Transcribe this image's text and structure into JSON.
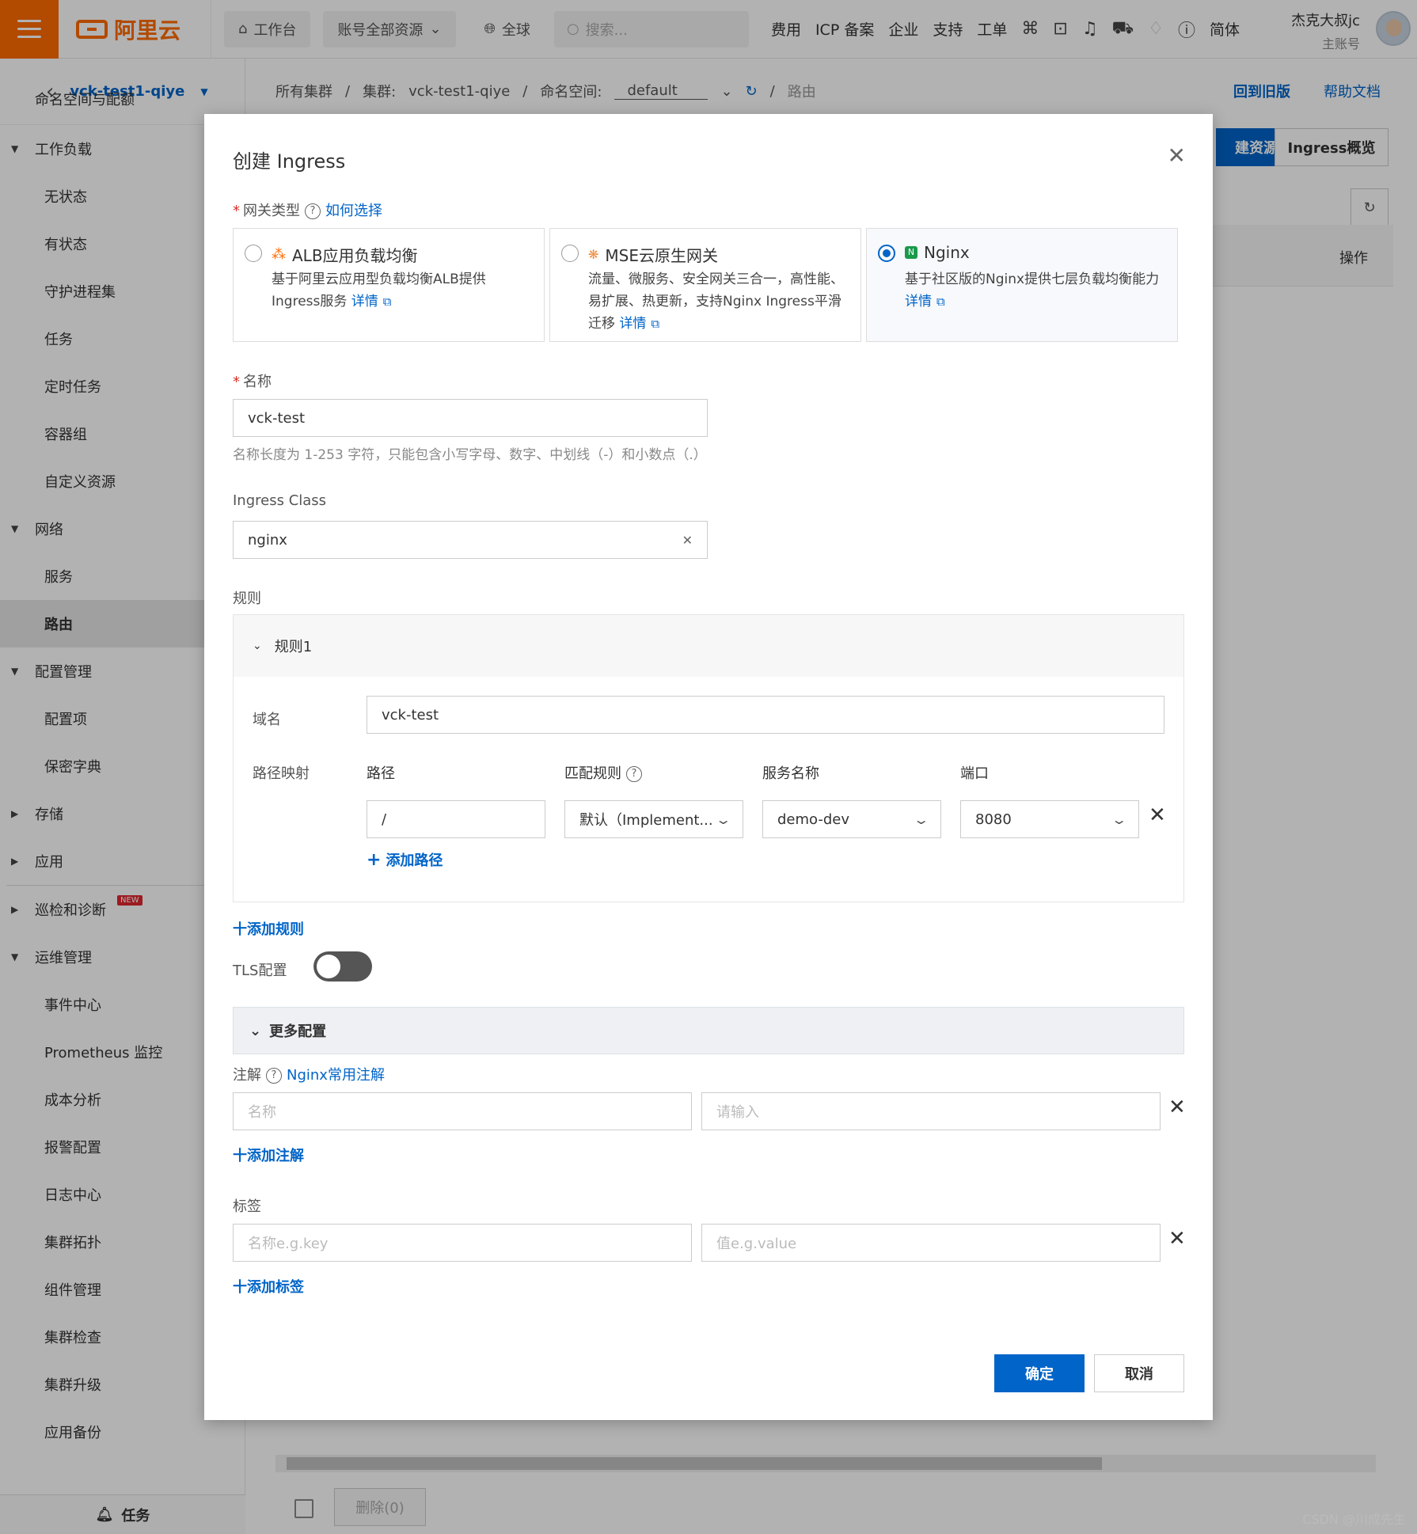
{
  "topbar": {
    "logo": "阿里云",
    "workbench": "工作台",
    "account_scope": "账号全部资源",
    "region": "全球",
    "search_placeholder": "搜索...",
    "links": [
      "费用",
      "ICP 备案",
      "企业",
      "支持",
      "工单"
    ],
    "lang": "简体",
    "user_name": "杰克大叔jc",
    "user_role": "主账号"
  },
  "sidebar": {
    "cluster": "vck-test1-qiye",
    "cut_item": "命名空间与配额",
    "items": [
      {
        "label": "工作负载",
        "type": "group",
        "caret": "▼"
      },
      {
        "label": "无状态",
        "type": "sub"
      },
      {
        "label": "有状态",
        "type": "sub"
      },
      {
        "label": "守护进程集",
        "type": "sub"
      },
      {
        "label": "任务",
        "type": "sub"
      },
      {
        "label": "定时任务",
        "type": "sub"
      },
      {
        "label": "容器组",
        "type": "sub"
      },
      {
        "label": "自定义资源",
        "type": "sub"
      },
      {
        "label": "网络",
        "type": "group",
        "caret": "▼"
      },
      {
        "label": "服务",
        "type": "sub"
      },
      {
        "label": "路由",
        "type": "sub",
        "active": true
      },
      {
        "label": "配置管理",
        "type": "group",
        "caret": "▼"
      },
      {
        "label": "配置项",
        "type": "sub"
      },
      {
        "label": "保密字典",
        "type": "sub"
      },
      {
        "label": "存储",
        "type": "group",
        "caret": "▶"
      },
      {
        "label": "应用",
        "type": "group",
        "caret": "▶"
      },
      {
        "label": "巡检和诊断",
        "type": "group",
        "caret": "▶",
        "badge": "NEW"
      },
      {
        "label": "运维管理",
        "type": "group",
        "caret": "▼"
      },
      {
        "label": "事件中心",
        "type": "sub"
      },
      {
        "label": "Prometheus 监控",
        "type": "sub"
      },
      {
        "label": "成本分析",
        "type": "sub"
      },
      {
        "label": "报警配置",
        "type": "sub"
      },
      {
        "label": "日志中心",
        "type": "sub"
      },
      {
        "label": "集群拓扑",
        "type": "sub"
      },
      {
        "label": "组件管理",
        "type": "sub"
      },
      {
        "label": "集群检查",
        "type": "sub"
      },
      {
        "label": "集群升级",
        "type": "sub"
      },
      {
        "label": "应用备份",
        "type": "sub"
      }
    ],
    "bottom": "任务"
  },
  "main": {
    "crumb_all": "所有集群",
    "crumb_cluster_label": "集群:",
    "crumb_cluster": "vck-test1-qiye",
    "crumb_ns_label": "命名空间:",
    "crumb_ns": "default",
    "crumb_page": "路由",
    "old_version": "回到旧版",
    "help_doc": "帮助文档",
    "create_btn_partial": "建资源",
    "overview_btn": "Ingress概览",
    "op_col": "操作",
    "delete_btn": "删除(0)",
    "watermark": "CSDN @川成先生"
  },
  "dialog": {
    "title": "创建 Ingress",
    "gateway_label": "网关类型",
    "how_to_choose": "如何选择",
    "cards": [
      {
        "title": "ALB应用负载均衡",
        "desc": "基于阿里云应用型负载均衡ALB提供Ingress服务",
        "link": "详情",
        "selected": false,
        "icon_color": "#ff6a00"
      },
      {
        "title": "MSE云原生网关",
        "desc": "流量、微服务、安全网关三合一，高性能、易扩展、热更新，支持Nginx Ingress平滑迁移",
        "link": "详情",
        "selected": false,
        "icon_color": "#f08a3a"
      },
      {
        "title": "Nginx",
        "desc": "基于社区版的Nginx提供七层负载均衡能力",
        "link": "详情",
        "selected": true,
        "icon_color": "#1a9a4a"
      }
    ],
    "name_label": "名称",
    "name_value": "vck-test",
    "name_hint": "名称长度为 1-253 字符，只能包含小写字母、数字、中划线（-）和小数点（.）",
    "class_label": "Ingress Class",
    "class_value": "nginx",
    "rules_label": "规则",
    "rule_title": "规则1",
    "domain_label": "域名",
    "domain_value": "vck-test",
    "path_map_label": "路径映射",
    "col_path": "路径",
    "col_match": "匹配规则",
    "col_service": "服务名称",
    "col_port": "端口",
    "path_value": "/",
    "match_value": "默认（Implement...",
    "service_value": "demo-dev",
    "port_value": "8080",
    "add_path": "添加路径",
    "add_rule": "十添加规则",
    "tls_label": "TLS配置",
    "tls_on": false,
    "more_config": "更多配置",
    "annot_label": "注解",
    "annot_link": "Nginx常用注解",
    "annot_name_ph": "名称",
    "annot_value_ph": "请输入",
    "add_annot": "十添加注解",
    "tag_label": "标签",
    "tag_name_ph": "名称e.g.key",
    "tag_value_ph": "值e.g.value",
    "add_tag": "十添加标签",
    "ok": "确定",
    "cancel": "取消"
  }
}
